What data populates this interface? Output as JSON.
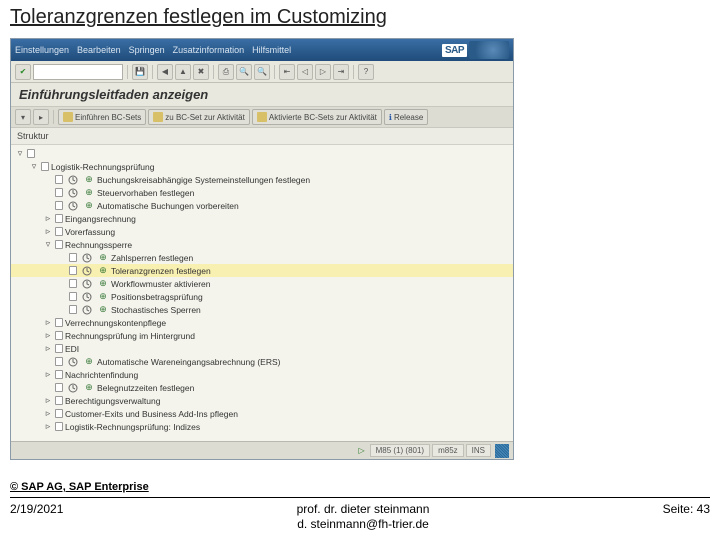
{
  "slide": {
    "title": "Toleranzgrenzen festlegen im Customizing",
    "copyright": "© SAP AG, SAP Enterprise",
    "date": "2/19/2021",
    "author_line1": "prof. dr. dieter steinmann",
    "author_line2": "d. steinmann@fh-trier.de",
    "page": "Seite: 43"
  },
  "sap": {
    "menu": {
      "m1": "Einstellungen",
      "m2": "Bearbeiten",
      "m3": "Springen",
      "m4": "Zusatzinformation",
      "m5": "Hilfsmittel"
    },
    "logo": "SAP",
    "app_title": "Einführungsleitfaden anzeigen",
    "tb": {
      "b1": "Einführen BC-Sets",
      "b2": "zu BC-Set zur Aktivität",
      "b3": "Aktivierte BC-Sets zur Aktivität",
      "b4": "Release"
    },
    "tree_header": "Struktur",
    "tree": [
      {
        "lvl": 0,
        "exp": "▿",
        "icons": [
          "doc"
        ],
        "label": ""
      },
      {
        "lvl": 1,
        "exp": "▿",
        "icons": [
          "doc"
        ],
        "label": "Logistik-Rechnungsprüfung"
      },
      {
        "lvl": 2,
        "exp": "",
        "icons": [
          "doc",
          "clock",
          "exec"
        ],
        "label": "Buchungskreisabhängige Systemeinstellungen festlegen"
      },
      {
        "lvl": 2,
        "exp": "",
        "icons": [
          "doc",
          "clock",
          "exec"
        ],
        "label": "Steuervorhaben festlegen"
      },
      {
        "lvl": 2,
        "exp": "",
        "icons": [
          "doc",
          "clock",
          "exec"
        ],
        "label": "Automatische Buchungen vorbereiten"
      },
      {
        "lvl": 2,
        "exp": "▹",
        "icons": [
          "doc"
        ],
        "label": "Eingangsrechnung"
      },
      {
        "lvl": 2,
        "exp": "▹",
        "icons": [
          "doc"
        ],
        "label": "Vorerfassung"
      },
      {
        "lvl": 2,
        "exp": "▿",
        "icons": [
          "doc"
        ],
        "label": "Rechnungssperre"
      },
      {
        "lvl": 3,
        "exp": "",
        "icons": [
          "doc",
          "clock",
          "exec"
        ],
        "label": "Zahlsperren festlegen",
        "hl": false
      },
      {
        "lvl": 3,
        "exp": "",
        "icons": [
          "doc",
          "clock",
          "exec"
        ],
        "label": "Toleranzgrenzen festlegen",
        "hl": true
      },
      {
        "lvl": 3,
        "exp": "",
        "icons": [
          "doc",
          "clock",
          "exec"
        ],
        "label": "Workflowmuster aktivieren",
        "hl": false
      },
      {
        "lvl": 3,
        "exp": "",
        "icons": [
          "doc",
          "clock",
          "exec"
        ],
        "label": "Positionsbetragsprüfung"
      },
      {
        "lvl": 3,
        "exp": "",
        "icons": [
          "doc",
          "clock",
          "exec"
        ],
        "label": "Stochastisches Sperren"
      },
      {
        "lvl": 2,
        "exp": "▹",
        "icons": [
          "doc"
        ],
        "label": "Verrechnungskontenpflege"
      },
      {
        "lvl": 2,
        "exp": "▹",
        "icons": [
          "doc"
        ],
        "label": "Rechnungsprüfung im Hintergrund"
      },
      {
        "lvl": 2,
        "exp": "▹",
        "icons": [
          "doc"
        ],
        "label": "EDI"
      },
      {
        "lvl": 2,
        "exp": "",
        "icons": [
          "doc",
          "clock",
          "exec"
        ],
        "label": "Automatische Wareneingangsabrechnung (ERS)"
      },
      {
        "lvl": 2,
        "exp": "▹",
        "icons": [
          "doc"
        ],
        "label": "Nachrichtenfindung"
      },
      {
        "lvl": 2,
        "exp": "",
        "icons": [
          "doc",
          "clock",
          "exec"
        ],
        "label": "Belegnutzzeiten festlegen"
      },
      {
        "lvl": 2,
        "exp": "▹",
        "icons": [
          "doc"
        ],
        "label": "Berechtigungsverwaltung"
      },
      {
        "lvl": 2,
        "exp": "▹",
        "icons": [
          "doc"
        ],
        "label": "Customer-Exits und Business Add-Ins pflegen"
      },
      {
        "lvl": 2,
        "exp": "▹",
        "icons": [
          "doc"
        ],
        "label": "Logistik-Rechnungsprüfung: Indizes"
      }
    ],
    "status": {
      "cell1": "M85 (1) (801)",
      "cell2": "m85z",
      "cell3": "INS"
    }
  }
}
